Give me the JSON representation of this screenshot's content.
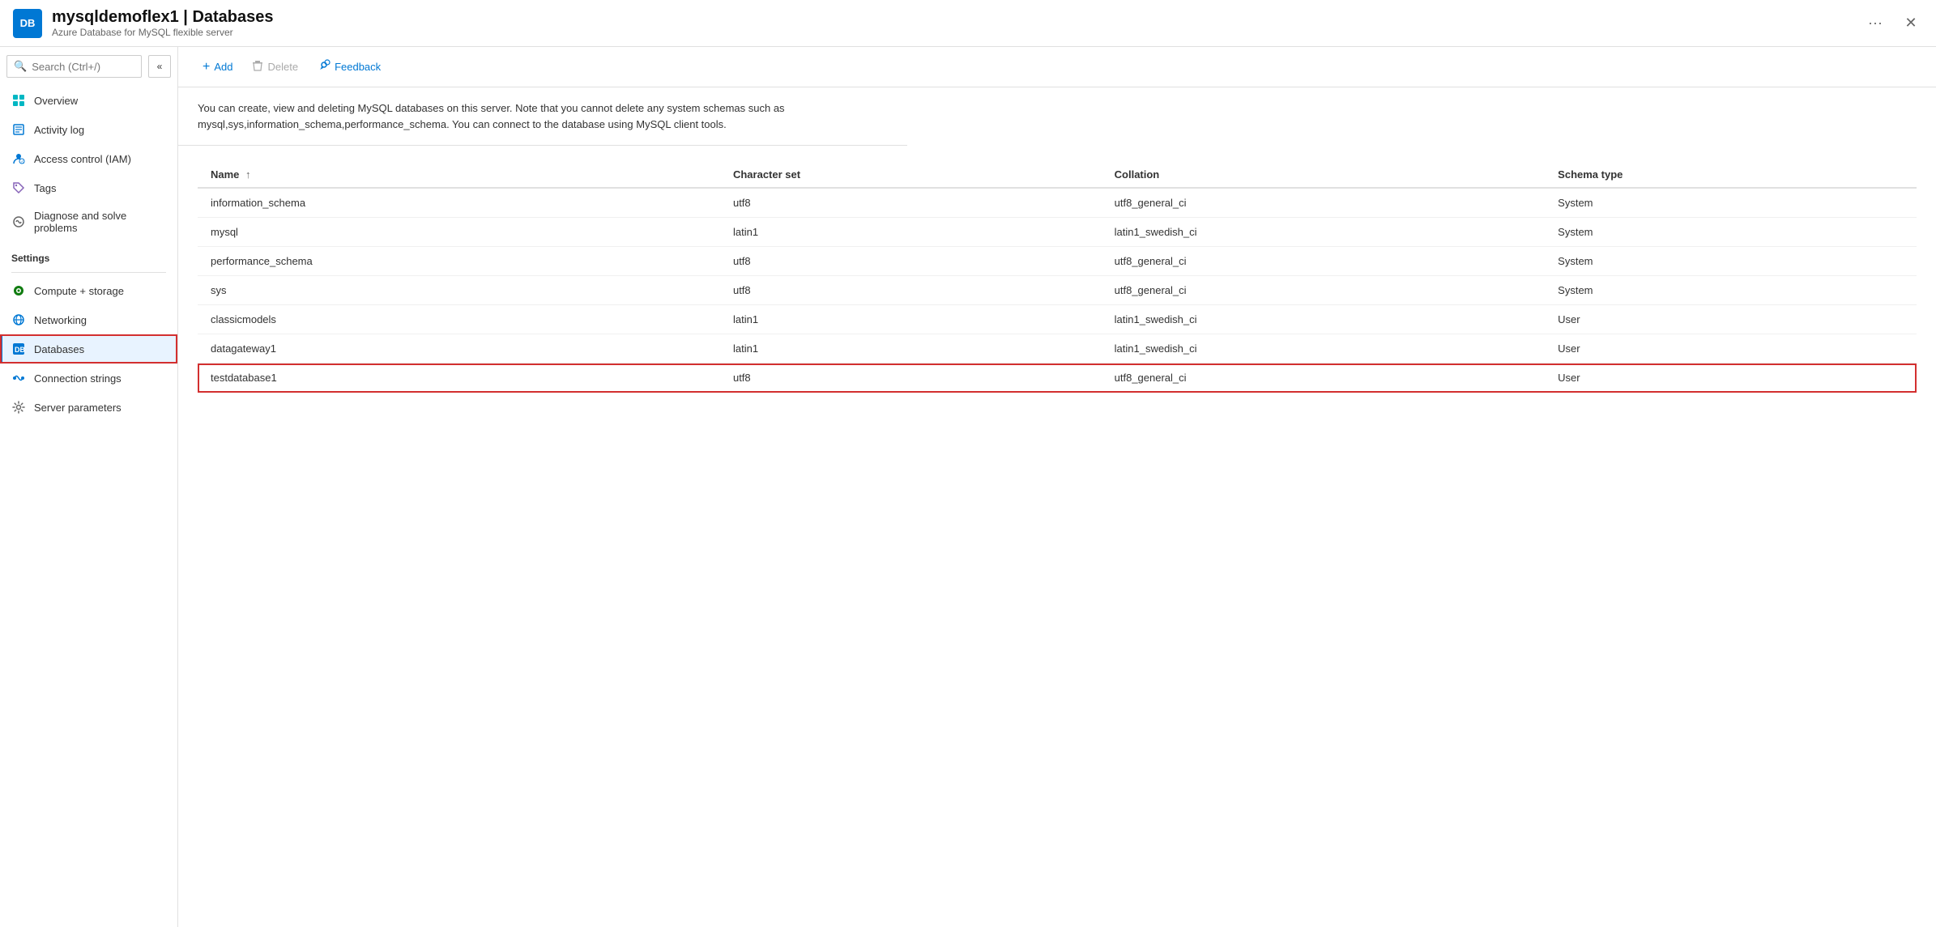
{
  "header": {
    "icon_text": "DB",
    "title": "mysqldemoflex1 | Databases",
    "subtitle": "Azure Database for MySQL flexible server",
    "ellipsis": "···",
    "close": "✕"
  },
  "sidebar": {
    "search_placeholder": "Search (Ctrl+/)",
    "collapse_icon": "«",
    "nav_items": [
      {
        "id": "overview",
        "label": "Overview",
        "icon": "my"
      },
      {
        "id": "activity-log",
        "label": "Activity log",
        "icon": "log"
      },
      {
        "id": "access-control",
        "label": "Access control (IAM)",
        "icon": "iam"
      },
      {
        "id": "tags",
        "label": "Tags",
        "icon": "tag"
      },
      {
        "id": "diagnose",
        "label": "Diagnose and solve problems",
        "icon": "wrench"
      }
    ],
    "settings_label": "Settings",
    "settings_items": [
      {
        "id": "compute-storage",
        "label": "Compute + storage",
        "icon": "compute"
      },
      {
        "id": "networking",
        "label": "Networking",
        "icon": "network"
      },
      {
        "id": "databases",
        "label": "Databases",
        "icon": "db",
        "active": true
      },
      {
        "id": "connection-strings",
        "label": "Connection strings",
        "icon": "plug"
      },
      {
        "id": "server-parameters",
        "label": "Server parameters",
        "icon": "gear"
      }
    ]
  },
  "toolbar": {
    "add_label": "Add",
    "delete_label": "Delete",
    "feedback_label": "Feedback"
  },
  "description": "You can create, view and deleting MySQL databases on this server. Note that you cannot delete any system schemas such as mysql,sys,information_schema,performance_schema. You can connect to the database using MySQL client tools.",
  "table": {
    "columns": [
      {
        "label": "Name",
        "sort": "↑"
      },
      {
        "label": "Character set",
        "sort": ""
      },
      {
        "label": "Collation",
        "sort": ""
      },
      {
        "label": "Schema type",
        "sort": ""
      }
    ],
    "rows": [
      {
        "name": "information_schema",
        "charset": "utf8",
        "collation": "utf8_general_ci",
        "schema_type": "System",
        "highlighted": false
      },
      {
        "name": "mysql",
        "charset": "latin1",
        "collation": "latin1_swedish_ci",
        "schema_type": "System",
        "highlighted": false
      },
      {
        "name": "performance_schema",
        "charset": "utf8",
        "collation": "utf8_general_ci",
        "schema_type": "System",
        "highlighted": false
      },
      {
        "name": "sys",
        "charset": "utf8",
        "collation": "utf8_general_ci",
        "schema_type": "System",
        "highlighted": false
      },
      {
        "name": "classicmodels",
        "charset": "latin1",
        "collation": "latin1_swedish_ci",
        "schema_type": "User",
        "highlighted": false
      },
      {
        "name": "datagateway1",
        "charset": "latin1",
        "collation": "latin1_swedish_ci",
        "schema_type": "User",
        "highlighted": false
      },
      {
        "name": "testdatabase1",
        "charset": "utf8",
        "collation": "utf8_general_ci",
        "schema_type": "User",
        "highlighted": true
      }
    ]
  }
}
